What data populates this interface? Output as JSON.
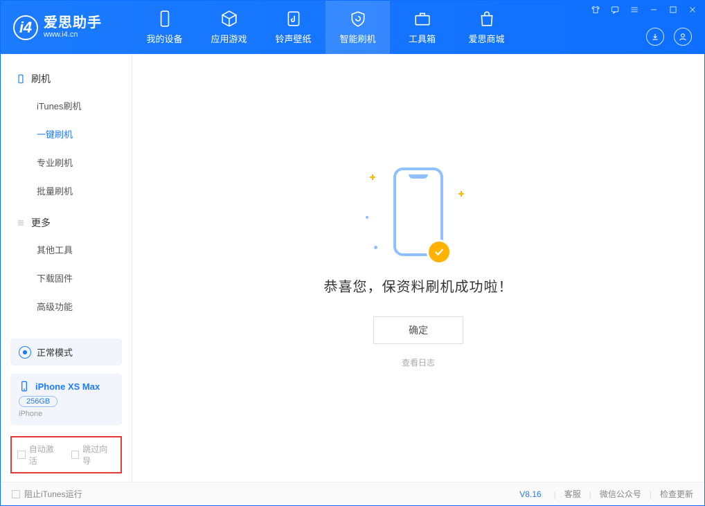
{
  "app": {
    "title": "爱思助手",
    "subtitle": "www.i4.cn"
  },
  "nav": {
    "items": [
      {
        "label": "我的设备"
      },
      {
        "label": "应用游戏"
      },
      {
        "label": "铃声壁纸"
      },
      {
        "label": "智能刷机"
      },
      {
        "label": "工具箱"
      },
      {
        "label": "爱思商城"
      }
    ]
  },
  "sidebar": {
    "section1_title": "刷机",
    "section1_items": [
      {
        "label": "iTunes刷机"
      },
      {
        "label": "一键刷机"
      },
      {
        "label": "专业刷机"
      },
      {
        "label": "批量刷机"
      }
    ],
    "section2_title": "更多",
    "section2_items": [
      {
        "label": "其他工具"
      },
      {
        "label": "下载固件"
      },
      {
        "label": "高级功能"
      }
    ],
    "mode": "正常模式",
    "device_name": "iPhone XS Max",
    "device_storage": "256GB",
    "device_type": "iPhone",
    "opt_auto_activate": "自动激活",
    "opt_skip_wizard": "跳过向导"
  },
  "main": {
    "success_text": "恭喜您，保资料刷机成功啦！",
    "ok_button": "确定",
    "view_log": "查看日志"
  },
  "statusbar": {
    "block_itunes": "阻止iTunes运行",
    "version": "V8.16",
    "links": [
      "客服",
      "微信公众号",
      "检查更新"
    ]
  }
}
